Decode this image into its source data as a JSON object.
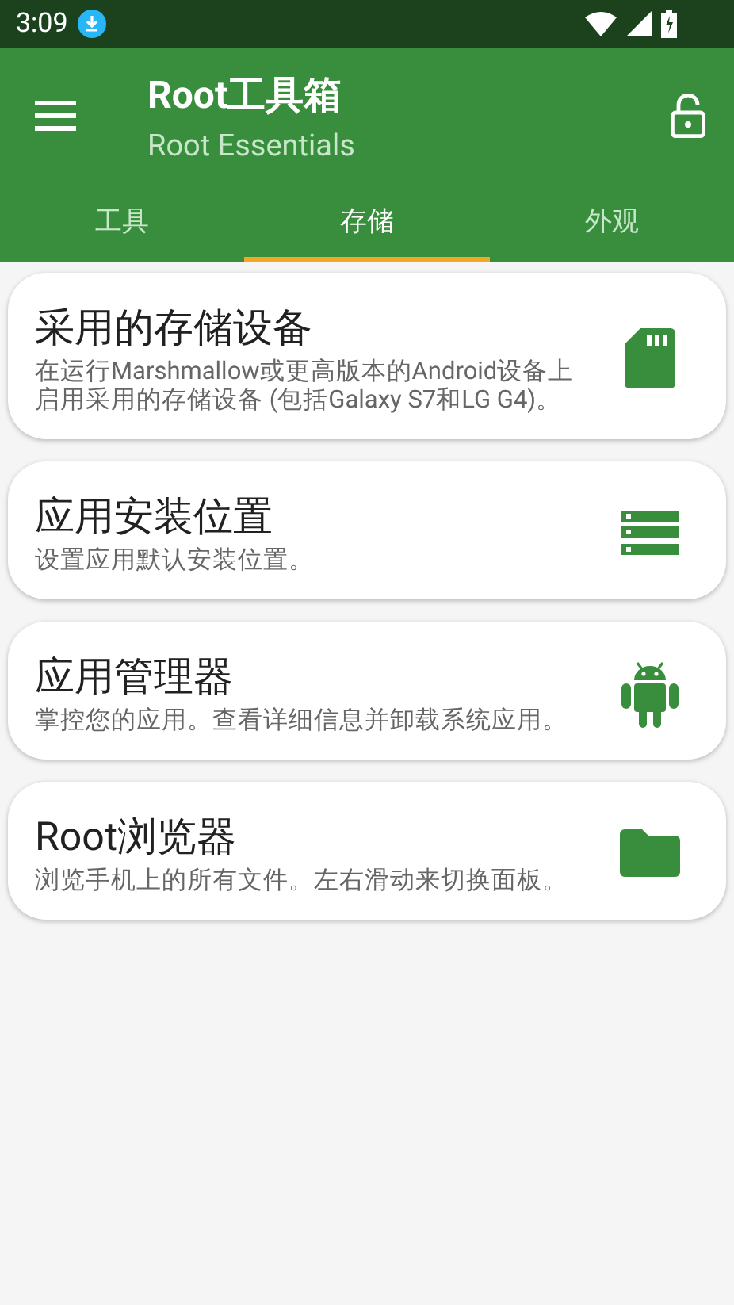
{
  "status_bar": {
    "time": "3:09"
  },
  "app_bar": {
    "title": "Root工具箱",
    "subtitle": "Root Essentials"
  },
  "tabs": [
    {
      "label": "工具",
      "selected": false
    },
    {
      "label": "存储",
      "selected": true
    },
    {
      "label": "外观",
      "selected": false
    }
  ],
  "cards": [
    {
      "kind": "sd-card",
      "title": "采用的存储设备",
      "description": "在运行Marshmallow或更高版本的Android设备上启用采用的存储设备 (包括Galaxy S7和LG G4)。"
    },
    {
      "kind": "storage",
      "title": "应用安装位置",
      "description": "设置应用默认安装位置。"
    },
    {
      "kind": "android",
      "title": "应用管理器",
      "description": "掌控您的应用。查看详细信息并卸载系统应用。"
    },
    {
      "kind": "folder",
      "title": "Root浏览器",
      "description": "浏览手机上的所有文件。左右滑动来切换面板。"
    }
  ]
}
